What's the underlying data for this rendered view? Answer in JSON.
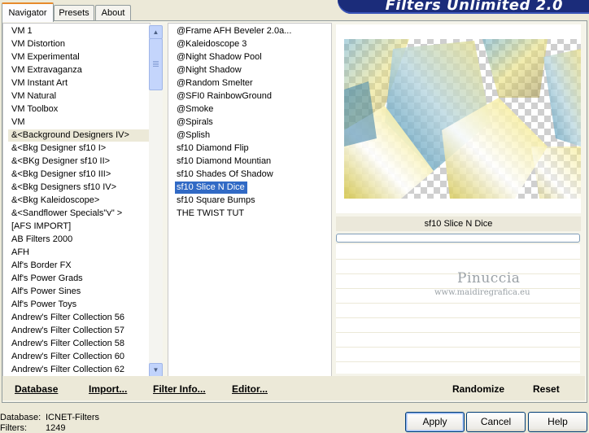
{
  "title": "Filters Unlimited 2.0",
  "tabs": [
    {
      "label": "Navigator",
      "active": true
    },
    {
      "label": "Presets",
      "active": false
    },
    {
      "label": "About",
      "active": false
    }
  ],
  "categories": {
    "selected": "&<Background Designers IV>",
    "items": [
      "VM 1",
      "VM Distortion",
      "VM Experimental",
      "VM Extravaganza",
      "VM Instant Art",
      "VM Natural",
      "VM Toolbox",
      "VM",
      "&<Background Designers IV>",
      "&<Bkg Designer sf10 I>",
      "&<BKg Designer sf10 II>",
      "&<Bkg Designer sf10 III>",
      "&<Bkg Designers sf10 IV>",
      "&<Bkg Kaleidoscope>",
      "&<Sandflower Specials\"v\" >",
      "[AFS IMPORT]",
      "AB Filters 2000",
      "AFH",
      "Alf's Border FX",
      "Alf's Power Grads",
      "Alf's Power Sines",
      "Alf's Power Toys",
      "Andrew's Filter Collection 56",
      "Andrew's Filter Collection 57",
      "Andrew's Filter Collection 58",
      "Andrew's Filter Collection 60",
      "Andrew's Filter Collection 62"
    ]
  },
  "filters": {
    "selected": "sf10 Slice N Dice",
    "items": [
      "@Frame AFH Beveler 2.0a...",
      "@Kaleidoscope 3",
      "@Night Shadow Pool",
      "@Night Shadow",
      "@Random Smelter",
      "@SFI0 RainbowGround",
      "@Smoke",
      "@Spirals",
      "@Splish",
      "sf10 Diamond Flip",
      "sf10 Diamond Mountian",
      "sf10 Shades Of Shadow",
      "sf10 Slice N Dice",
      "sf10 Square Bumps",
      "THE TWIST TUT"
    ]
  },
  "preview": {
    "filter_name": "sf10 Slice N Dice",
    "progress": 0
  },
  "watermark": {
    "name": "Pinuccia",
    "url": "www.maidiregrafica.eu"
  },
  "buttons": {
    "database": "Database",
    "import": "Import...",
    "filter_info": "Filter Info...",
    "editor": "Editor...",
    "randomize": "Randomize",
    "reset": "Reset",
    "apply": "Apply",
    "cancel": "Cancel",
    "help": "Help"
  },
  "status": {
    "database_label": "Database:",
    "database_value": "ICNET-Filters",
    "filters_label": "Filters:",
    "filters_value": "1249"
  },
  "colors": {
    "banner": "#1b2c7a",
    "selection": "#316ac5",
    "panel": "#ece9d8"
  }
}
